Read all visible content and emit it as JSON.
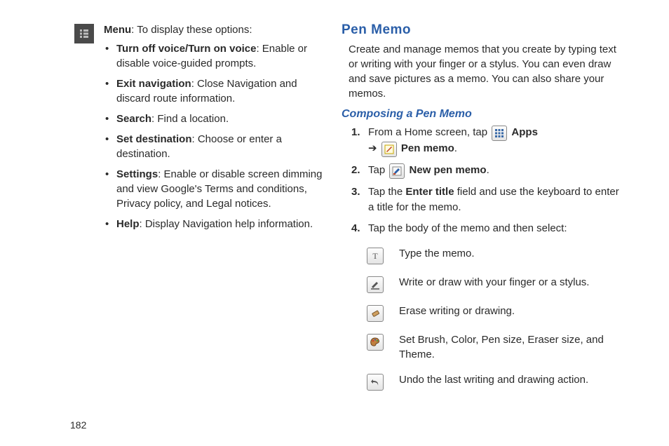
{
  "pageNumber": "182",
  "left": {
    "menuLabel": "Menu",
    "menuIntro": ": To display these options:",
    "items": [
      {
        "title": "Turn off voice/Turn on voice",
        "desc": ": Enable or disable voice-guided prompts."
      },
      {
        "title": "Exit navigation",
        "desc": ": Close Navigation and discard route information."
      },
      {
        "title": "Search",
        "desc": ": Find a location."
      },
      {
        "title": "Set destination",
        "desc": ": Choose or enter a destination."
      },
      {
        "title": "Settings",
        "desc": ": Enable or disable screen dimming and view Google's Terms and conditions, Privacy policy, and Legal notices."
      },
      {
        "title": "Help",
        "desc": ": Display Navigation help information."
      }
    ]
  },
  "right": {
    "heading": "Pen Memo",
    "intro": "Create and manage memos that you create by typing text or writing with your finger or a stylus. You can even draw and save pictures as a memo. You can also share your memos.",
    "sub": "Composing a Pen Memo",
    "step1_a": "From a Home screen, tap ",
    "step1_apps": "Apps",
    "step1_arrow": "➔ ",
    "step1_penmemo": "Pen memo",
    "step1_end": ".",
    "step2_a": "Tap ",
    "step2_b": "New pen memo",
    "step2_end": ".",
    "step3_a": "Tap the ",
    "step3_b": "Enter title",
    "step3_c": " field and use the keyboard to enter a title for the memo.",
    "step4": "Tap the body of the memo and then select:",
    "options": [
      "Type the memo.",
      "Write or draw with your finger or a stylus.",
      "Erase writing or drawing.",
      "Set Brush, Color, Pen size, Eraser size, and Theme.",
      "Undo the last writing and drawing action."
    ]
  }
}
